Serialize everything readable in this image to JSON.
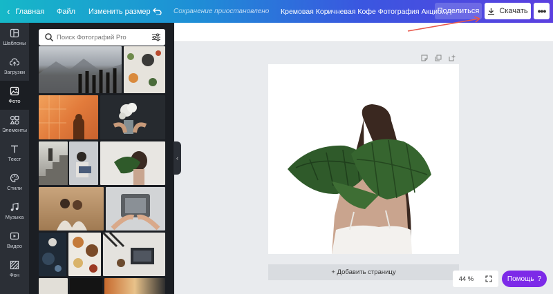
{
  "topbar": {
    "home_label": "Главная",
    "file_label": "Файл",
    "resize_label": "Изменить размер",
    "status": "Сохранение приостановлено",
    "title": "Кремовая Коричневая Кофе Фотография Акцио...",
    "share_label": "Поделиться",
    "download_label": "Скачать",
    "more_label": "•••"
  },
  "rail": {
    "items": [
      {
        "label": "Шаблоны",
        "icon": "templates-icon"
      },
      {
        "label": "Загрузки",
        "icon": "upload-cloud-icon"
      },
      {
        "label": "Фото",
        "icon": "photo-icon"
      },
      {
        "label": "Элементы",
        "icon": "elements-icon"
      },
      {
        "label": "Текст",
        "icon": "text-icon"
      },
      {
        "label": "Стили",
        "icon": "palette-icon"
      },
      {
        "label": "Музыка",
        "icon": "music-icon"
      },
      {
        "label": "Видео",
        "icon": "video-icon"
      },
      {
        "label": "Фон",
        "icon": "background-icon"
      }
    ],
    "active_index": 2
  },
  "panel": {
    "search_placeholder": "Поиск Фотографий Pro"
  },
  "canvas": {
    "add_page_label": "+ Добавить страницу",
    "zoom": "44 %",
    "help_label": "Помощь",
    "help_q": "?"
  },
  "colors": {
    "accent_purple": "#7d2ae8",
    "annotation_arrow": "#e8574a"
  }
}
